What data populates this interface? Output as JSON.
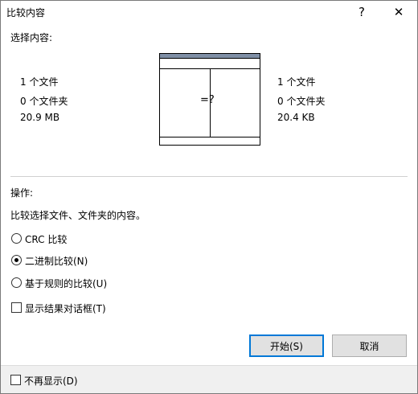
{
  "window": {
    "title": "比较内容",
    "help_label": "?",
    "close_label": "✕"
  },
  "selection": {
    "heading": "选择内容:",
    "left": {
      "files": "1 个文件",
      "folders": "0 个文件夹",
      "size": "20.9 MB"
    },
    "right": {
      "files": "1 个文件",
      "folders": "0 个文件夹",
      "size": "20.4 KB"
    },
    "preview_symbol": "=?"
  },
  "operation": {
    "heading": "操作:",
    "description": "比较选择文件、文件夹的内容。",
    "options": [
      {
        "label": "CRC 比较",
        "checked": false
      },
      {
        "label": "二进制比较(N)",
        "checked": true
      },
      {
        "label": "基于规则的比较(U)",
        "checked": false
      }
    ],
    "show_results_label": "显示结果对话框(T)"
  },
  "buttons": {
    "start": "开始(S)",
    "cancel": "取消"
  },
  "footer": {
    "dont_show_label": "不再显示(D)"
  }
}
